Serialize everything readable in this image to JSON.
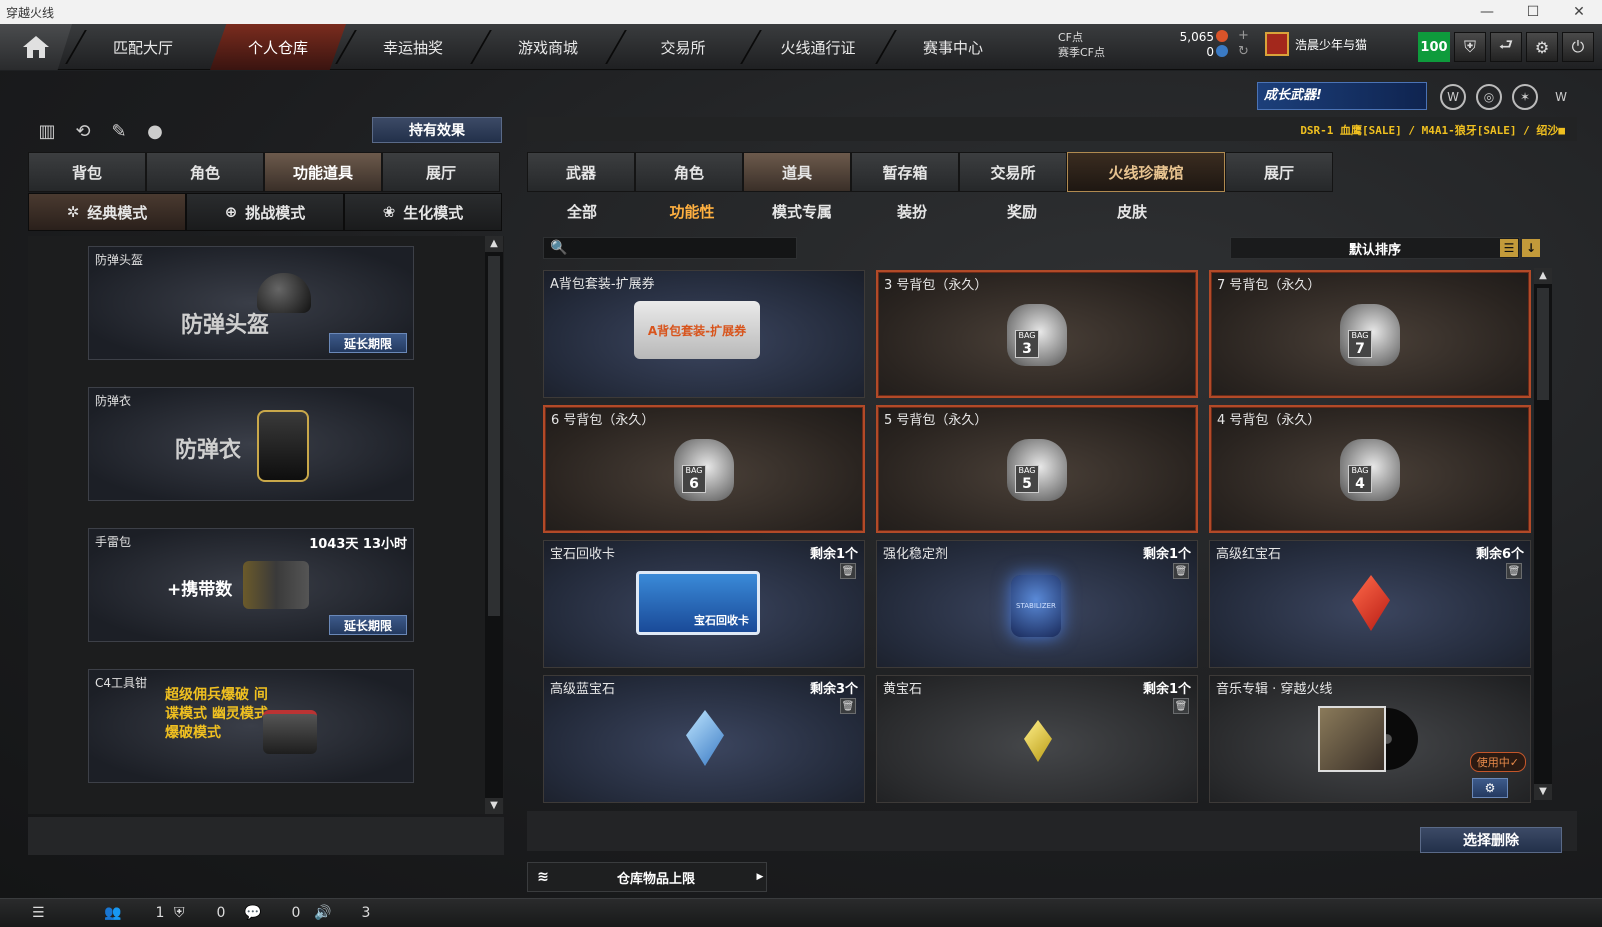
{
  "window": {
    "title": "穿越火线",
    "minimize": "—",
    "maximize": "☐",
    "close": "✕"
  },
  "nav": {
    "items": [
      "匹配大厅",
      "个人仓库",
      "幸运抽奖",
      "游戏商城",
      "交易所",
      "火线通行证",
      "赛事中心"
    ],
    "active_index": 1,
    "cf_label": "CF点",
    "season_cf_label": "赛季CF点",
    "cf_value": "5,065",
    "season_cf_value": "0",
    "username": "浩晨少年与猫",
    "level": "100"
  },
  "left": {
    "hold_effect": "持有效果",
    "tabs": [
      "背包",
      "角色",
      "功能道具",
      "展厅"
    ],
    "active_tab": 2,
    "modes": [
      "经典模式",
      "挑战模式",
      "生化模式"
    ],
    "active_mode": 0,
    "cards": [
      {
        "caption": "防弹头盔",
        "big": "防弹头盔",
        "right": "",
        "button": "延长期限"
      },
      {
        "caption": "防弹衣",
        "big": "防弹衣",
        "right": "",
        "button": ""
      },
      {
        "caption": "手雷包",
        "big": "+携带数",
        "right": "1043天 13小时",
        "button": "延长期限"
      },
      {
        "caption": "C4工具钳",
        "big": "超级佣兵爆破 间谍模式 幽灵模式 爆破模式",
        "right": "",
        "button": ""
      }
    ]
  },
  "right": {
    "banner": "成长武器!",
    "ticker": "DSR-1 血鹰[SALE] / M4A1-狼牙[SALE] / 绍沙■",
    "tabs": [
      "武器",
      "角色",
      "道具",
      "暂存箱",
      "交易所",
      "火线珍藏馆",
      "展厅"
    ],
    "active_tab": 2,
    "sub_tabs": [
      "全部",
      "功能性",
      "模式专属",
      "装扮",
      "奖励",
      "皮肤"
    ],
    "active_sub": 1,
    "search_placeholder": "",
    "sort_label": "默认排序",
    "items": [
      {
        "name": "A背包套装-扩展券",
        "count": "",
        "art": "A背包套装-扩展券",
        "bag": "",
        "style": "blue"
      },
      {
        "name": "3 号背包（永久）",
        "count": "",
        "art": "",
        "bag": "3",
        "style": "hl"
      },
      {
        "name": "7 号背包（永久）",
        "count": "",
        "art": "",
        "bag": "7",
        "style": "hl"
      },
      {
        "name": "6 号背包（永久）",
        "count": "",
        "art": "",
        "bag": "6",
        "style": "hl"
      },
      {
        "name": "5 号背包（永久）",
        "count": "",
        "art": "",
        "bag": "5",
        "style": "hl"
      },
      {
        "name": "4 号背包（永久）",
        "count": "",
        "art": "",
        "bag": "4",
        "style": "hl"
      },
      {
        "name": "宝石回收卡",
        "count": "剩余1个",
        "art": "宝石回收卡",
        "bag": "",
        "style": "blue"
      },
      {
        "name": "强化稳定剂",
        "count": "剩余1个",
        "art": "STABILIZER",
        "bag": "",
        "style": "blue"
      },
      {
        "name": "高级红宝石",
        "count": "剩余6个",
        "art": "",
        "bag": "",
        "style": "blue"
      },
      {
        "name": "高级蓝宝石",
        "count": "剩余3个",
        "art": "",
        "bag": "",
        "style": "blue"
      },
      {
        "name": "黄宝石",
        "count": "剩余1个",
        "art": "",
        "bag": "",
        "style": "gray"
      },
      {
        "name": "音乐专辑 · 穿越火线",
        "count": "",
        "art": "",
        "bag": "",
        "style": "gray",
        "in_use": "使用中✓"
      }
    ],
    "bag_label": "BAG",
    "select_delete": "选择删除",
    "capacity_label": "仓库物品上限"
  },
  "statusbar": {
    "friends": "1",
    "clan": "0",
    "chat": "0",
    "voice": "3"
  },
  "colors": {
    "accent_orange": "#b24a28",
    "gold_text": "#f0c020",
    "active_sub": "#ffb040",
    "level_green": "#0e9b3c"
  }
}
